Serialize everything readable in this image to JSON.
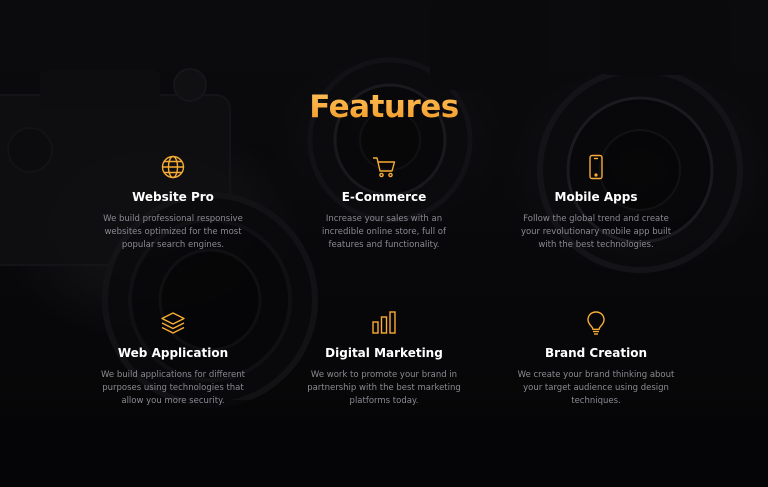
{
  "section": {
    "title": "Features"
  },
  "features": [
    {
      "icon": "globe-icon",
      "title": "Website Pro",
      "description": "We build professional responsive websites optimized for the most popular search engines."
    },
    {
      "icon": "shopping-cart-icon",
      "title": "E-Commerce",
      "description": "Increase your sales with an incredible online store, full of features and functionality."
    },
    {
      "icon": "mobile-phone-icon",
      "title": "Mobile Apps",
      "description": "Follow the global trend and create your revolutionary mobile app built with the best technologies."
    },
    {
      "icon": "layers-icon",
      "title": "Web Application",
      "description": "We build applications for different purposes using technologies that allow you more security."
    },
    {
      "icon": "bar-chart-icon",
      "title": "Digital Marketing",
      "description": "We work to promote your brand in partnership with the best marketing platforms today."
    },
    {
      "icon": "lightbulb-icon",
      "title": "Brand Creation",
      "description": "We create your brand thinking about your target audience using design techniques."
    }
  ],
  "colors": {
    "accent": "#f8ac36",
    "heading": "#ffffff",
    "body_text": "#8a8a92",
    "background": "#0b0b0d"
  }
}
